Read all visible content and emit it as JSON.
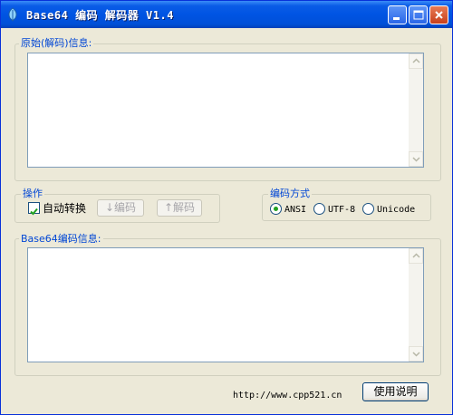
{
  "window": {
    "title": "Base64 编码 解码器 V1.4",
    "icons": {
      "app": "app-leaf-icon",
      "minimize": "minimize-icon",
      "maximize": "maximize-icon",
      "close": "close-icon"
    }
  },
  "source_group": {
    "label": "原始(解码)信息:",
    "text": ""
  },
  "operation_group": {
    "label": "操作",
    "auto_convert_label": "自动转换",
    "auto_convert_checked": true,
    "encode_button": "↓编码",
    "decode_button": "↑解码"
  },
  "encoding_group": {
    "label": "编码方式",
    "options": [
      "ANSI",
      "UTF-8",
      "Unicode"
    ],
    "selected": "ANSI"
  },
  "encoded_group": {
    "label": "Base64编码信息:",
    "text": ""
  },
  "footer": {
    "url": "http://www.cpp521.cn",
    "help_button": "使用说明"
  },
  "colors": {
    "titlebar": "#0054e3",
    "group_label": "#0046d5",
    "window_bg": "#ece9d8",
    "radio_dot": "#21a121"
  }
}
